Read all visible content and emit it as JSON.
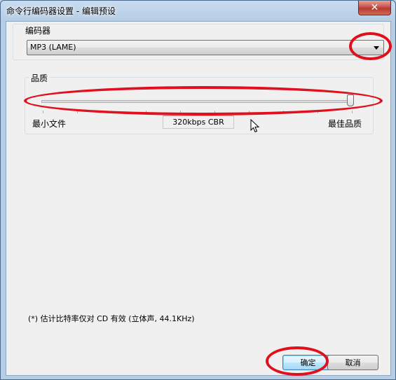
{
  "window": {
    "title": "命令行编码器设置 - 编辑预设",
    "close_symbol": "✕"
  },
  "encoder": {
    "group_label": "编码器",
    "selected_value": "MP3 (LAME)"
  },
  "quality": {
    "group_label": "品质",
    "min_label": "最小文件",
    "max_label": "最佳品质",
    "bitrate_text": "320kbps CBR",
    "slider_level_fraction": 1.0
  },
  "note": "(*) 估计比特率仅对 CD 有效 (立体声, 44.1KHz)",
  "buttons": {
    "ok_label": "确定",
    "cancel_label": "取消"
  },
  "annotation_color": "#e0101c"
}
